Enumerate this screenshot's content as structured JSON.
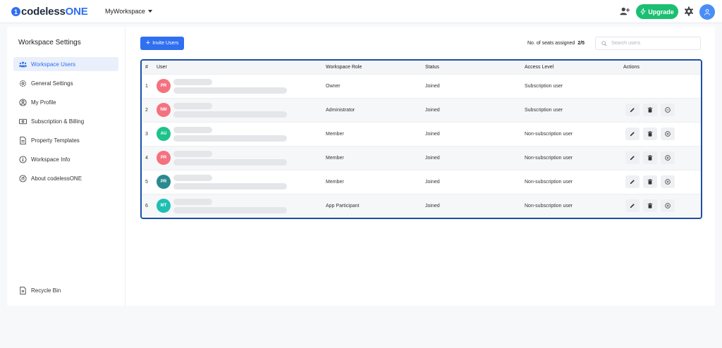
{
  "brand": {
    "name_part1": "codeless",
    "name_part2": "ONE",
    "mark": "1",
    "accent": "#2f6ff0"
  },
  "header": {
    "workspace_name": "MyWorkspace",
    "upgrade_label": "Upgrade",
    "icons": [
      "add-user-icon",
      "lightning-icon",
      "gear-icon",
      "user-avatar-icon"
    ],
    "upgrade_color": "#1bbf72"
  },
  "sidebar": {
    "title": "Workspace Settings",
    "items": [
      {
        "label": "Workspace Users",
        "icon": "users-icon",
        "active": true
      },
      {
        "label": "General Settings",
        "icon": "settings-icon",
        "active": false
      },
      {
        "label": "My Profile",
        "icon": "profile-icon",
        "active": false
      },
      {
        "label": "Subscription & Billing",
        "icon": "billing-icon",
        "active": false
      },
      {
        "label": "Property Templates",
        "icon": "template-icon",
        "active": false
      },
      {
        "label": "Workspace Info",
        "icon": "info-icon",
        "active": false
      },
      {
        "label": "About codelessONE",
        "icon": "about-icon",
        "active": false
      }
    ],
    "recycle_bin": "Recycle Bin"
  },
  "toolbar": {
    "invite_label": "Invite Users",
    "seats_label": "No. of seats assigned",
    "seats_value": "2/5",
    "search_placeholder": "Search users"
  },
  "table": {
    "headers": [
      "#",
      "User",
      "Workspace Role",
      "Status",
      "Access Level",
      "Actions"
    ],
    "rows": [
      {
        "num": "1",
        "initials": "PR",
        "avatar_color": "#f4727f",
        "role": "Owner",
        "status": "Joined",
        "access": "Subscription user",
        "actions": []
      },
      {
        "num": "2",
        "initials": "NM",
        "avatar_color": "#f4727f",
        "role": "Administrator",
        "status": "Joined",
        "access": "Subscription user",
        "actions": [
          "edit-icon",
          "delete-icon",
          "downgrade-icon"
        ]
      },
      {
        "num": "3",
        "initials": "AU",
        "avatar_color": "#1ec28b",
        "role": "Member",
        "status": "Joined",
        "access": "Non-subscription user",
        "actions": [
          "edit-icon",
          "delete-icon",
          "upgrade-icon"
        ]
      },
      {
        "num": "4",
        "initials": "PR",
        "avatar_color": "#f4727f",
        "role": "Member",
        "status": "Joined",
        "access": "Non-subscription user",
        "actions": [
          "edit-icon",
          "delete-icon",
          "upgrade-icon"
        ]
      },
      {
        "num": "5",
        "initials": "PR",
        "avatar_color": "#2a8a8f",
        "role": "Member",
        "status": "Joined",
        "access": "Non-subscription user",
        "actions": [
          "edit-icon",
          "delete-icon",
          "upgrade-icon"
        ]
      },
      {
        "num": "6",
        "initials": "MT",
        "avatar_color": "#1fbfb3",
        "role": "App Participant",
        "status": "Joined",
        "access": "Non-subscription user",
        "actions": [
          "edit-icon",
          "delete-icon",
          "upgrade-icon"
        ]
      }
    ]
  }
}
